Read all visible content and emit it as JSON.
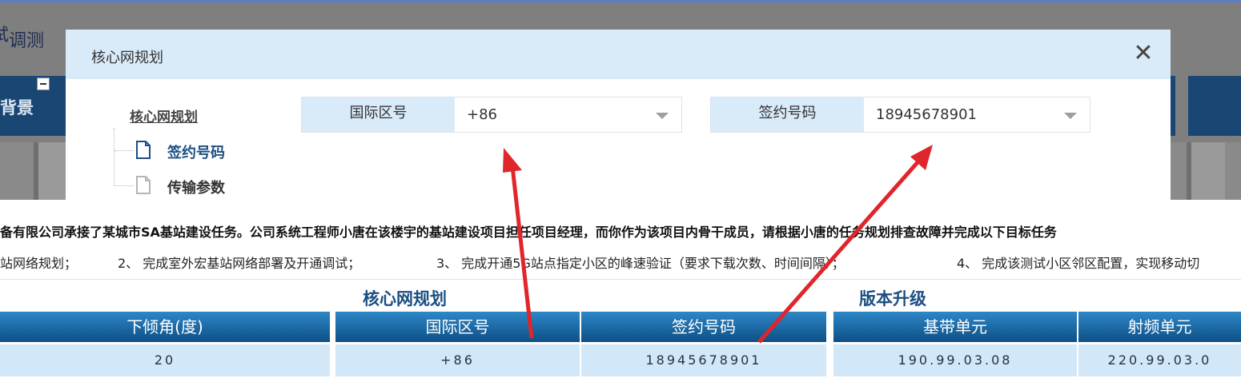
{
  "background": {
    "title": "调测",
    "title_partial_glyph": "试",
    "banner_text": "验背景"
  },
  "modal": {
    "title": "核心网规划",
    "close_glyph": "✕",
    "tree": {
      "root": "核心网规划",
      "children": [
        "签约号码",
        "传输参数"
      ]
    },
    "fields": [
      {
        "label": "国际区号",
        "value": "+86"
      },
      {
        "label": "签约号码",
        "value": "18945678901"
      }
    ]
  },
  "page": {
    "description_line1": "备有限公司承接了某城市SA基站建设任务。公司系统工程师小唐在该楼宇的基站建设项目担任项目经理，而你作为该项目内骨干成员，请根据小唐的任务规划排查故障并完成以下目标任务",
    "tasks": [
      {
        "text": "站网络规划；"
      },
      {
        "text": "2、 完成室外宏基站网络部署及开通调试；"
      },
      {
        "text": "3、 完成开通5G站点指定小区的峰速验证（要求下载次数、时间间隔）；"
      },
      {
        "text": "4、 完成该测试小区邻区配置，实现移动切"
      }
    ],
    "sections": [
      {
        "title": "核心网规划"
      },
      {
        "title": "版本升级"
      }
    ],
    "table": {
      "headers": [
        "下倾角(度)",
        "国际区号",
        "签约号码",
        "基带单元",
        "射频单元"
      ],
      "values": [
        "20",
        "+86",
        "18945678901",
        "190.99.03.08",
        "220.99.03.0"
      ]
    }
  },
  "colors": {
    "annotation_arrow": "#e0252b",
    "header_blue": "#1c6aa9",
    "modal_header": "#d9eaf9"
  }
}
